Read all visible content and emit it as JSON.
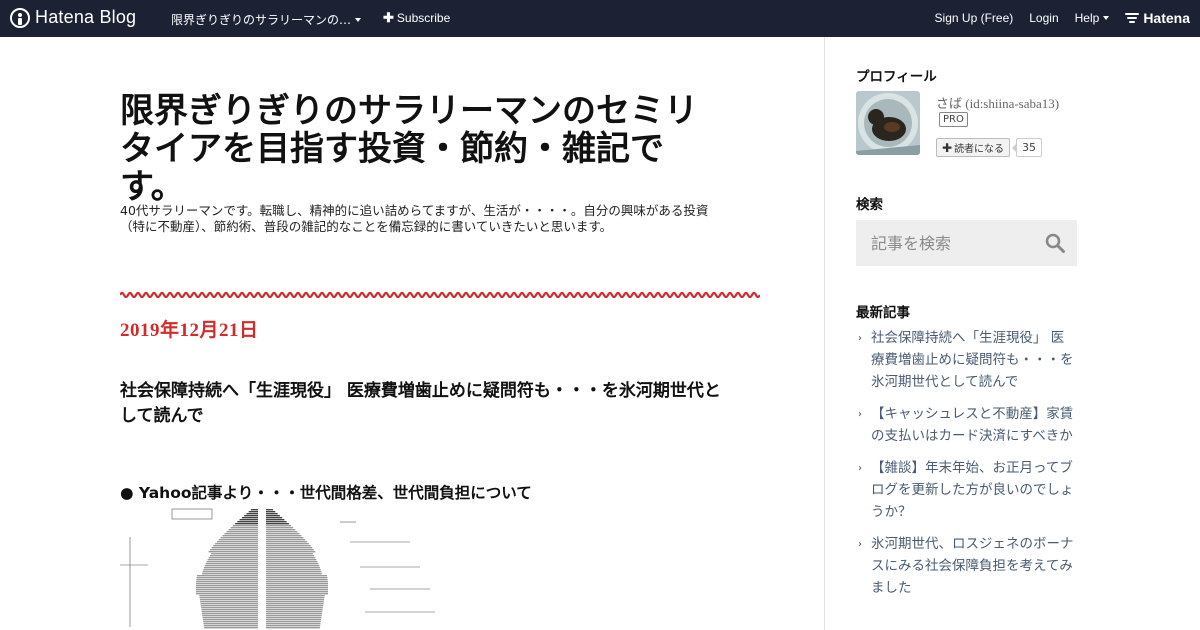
{
  "topbar": {
    "brand": "Hatena Blog",
    "blog_switch": "限界ぎりぎりのサラリーマンの…",
    "subscribe": "Subscribe",
    "signup": "Sign Up (Free)",
    "login": "Login",
    "help": "Help",
    "hatena": "Hatena"
  },
  "blog": {
    "title": "限界ぎりぎりのサラリーマンのセミリタイアを目指す投資・節約・雑記です。",
    "description": "40代サラリーマンです。転職し、精神的に追い詰めらてますが、生活が・・・・。自分の興味がある投資（特に不動産）、節約術、普段の雑記的なことを備忘録的に書いていきたいと思います。"
  },
  "post": {
    "date": "2019年12月21日",
    "title": "社会保障持続へ「生涯現役」 医療費増歯止めに疑問符も・・・を氷河期世代として読んで",
    "section_heading": "● Yahoo記事より・・・世代間格差、世代間負担について"
  },
  "sidebar": {
    "profile": {
      "heading": "プロフィール",
      "name": "さば (id:shiina-saba13)",
      "badge": "PRO",
      "reader_button": "読者になる",
      "reader_count": "35"
    },
    "search": {
      "heading": "検索",
      "placeholder": "記事を検索"
    },
    "recent": {
      "heading": "最新記事",
      "items": [
        "社会保障持続へ「生涯現役」 医療費増歯止めに疑問符も・・・を氷河期世代として読んで",
        "【キャッシュレスと不動産】家賃の支払いはカード決済にすべきか",
        "【雑談】年末年始、お正月ってブログを更新した方が良いのでしょうか？",
        "氷河期世代、ロスジェネのボーナスにみる社会保障負担を考えてみました"
      ]
    }
  },
  "colors": {
    "topbar_bg": "#1c2233",
    "date_red": "#d12b2b",
    "link": "#4a5c72"
  }
}
